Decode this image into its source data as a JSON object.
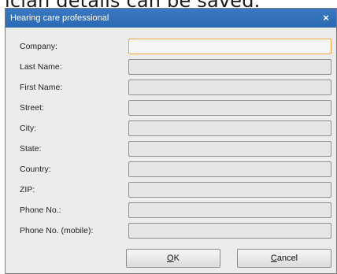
{
  "background_text": "ician details can be saved.",
  "dialog": {
    "title": "Hearing care professional",
    "close_glyph": "×"
  },
  "fields": [
    {
      "label": "Company:",
      "value": ""
    },
    {
      "label": "Last Name:",
      "value": ""
    },
    {
      "label": "First Name:",
      "value": ""
    },
    {
      "label": "Street:",
      "value": ""
    },
    {
      "label": "City:",
      "value": ""
    },
    {
      "label": "State:",
      "value": ""
    },
    {
      "label": "Country:",
      "value": ""
    },
    {
      "label": "ZIP:",
      "value": ""
    },
    {
      "label": "Phone No.:",
      "value": ""
    },
    {
      "label": "Phone No. (mobile):",
      "value": ""
    }
  ],
  "buttons": {
    "ok": {
      "mnemonic": "O",
      "rest": "K"
    },
    "cancel": {
      "mnemonic": "C",
      "rest": "ancel"
    }
  },
  "colors": {
    "titlebar": "#2d69b3",
    "focus_border": "#f0a43c",
    "dialog_bg": "#ececec"
  }
}
